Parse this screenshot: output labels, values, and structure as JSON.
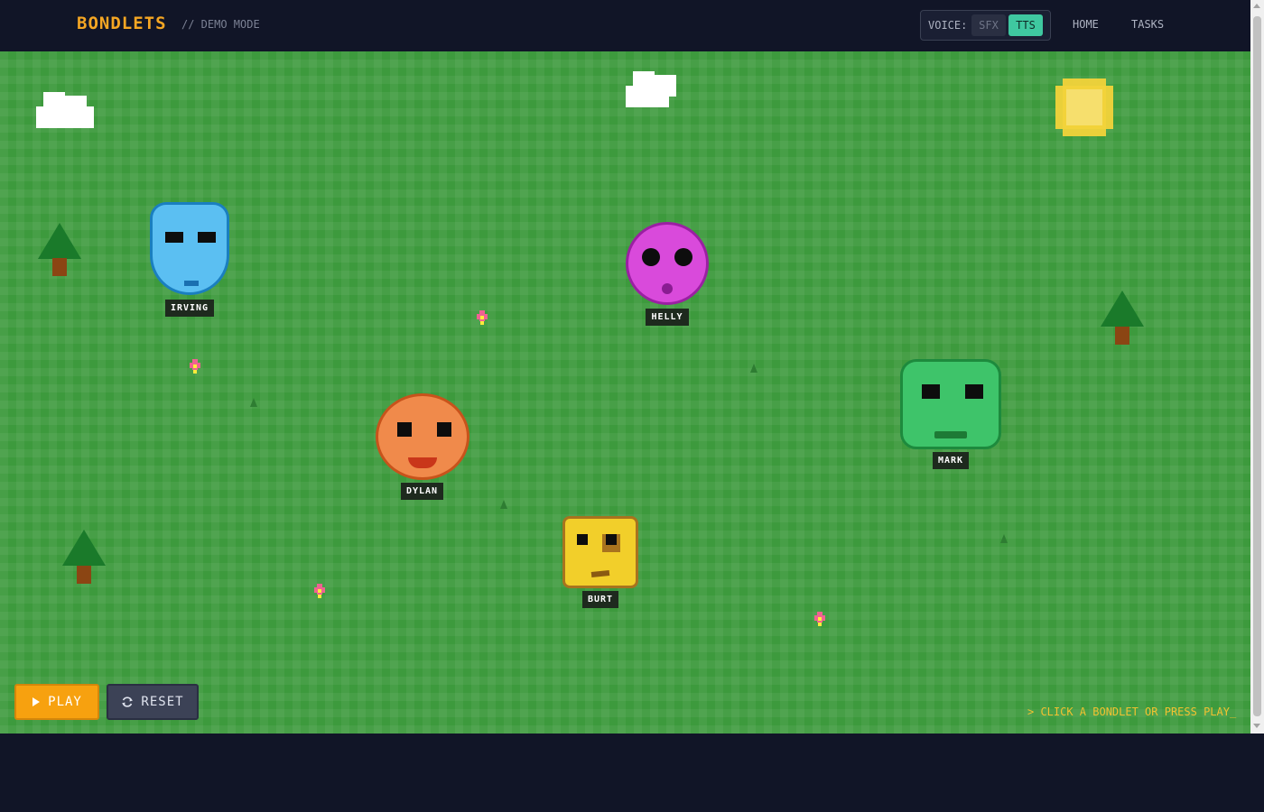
{
  "header": {
    "brand": "BONDLETS",
    "mode": "// DEMO MODE",
    "voice": {
      "label": "VOICE:",
      "options": [
        "SFX",
        "TTS"
      ],
      "selected": "TTS"
    },
    "nav": [
      "HOME",
      "TASKS"
    ]
  },
  "bondlets": [
    {
      "name": "IRVING",
      "color": "#5bbff2"
    },
    {
      "name": "HELLY",
      "color": "#d94adb"
    },
    {
      "name": "DYLAN",
      "color": "#f08a4b"
    },
    {
      "name": "MARK",
      "color": "#3ec46a"
    },
    {
      "name": "BURT",
      "color": "#f2cf2a"
    }
  ],
  "controls": {
    "play_label": "PLAY",
    "reset_label": "RESET"
  },
  "hint": "> CLICK A BONDLET OR PRESS PLAY_",
  "colors": {
    "background": "#111527",
    "field": "#3d9a3d",
    "accent": "#f5a623",
    "voice_active": "#3fc8a0"
  }
}
